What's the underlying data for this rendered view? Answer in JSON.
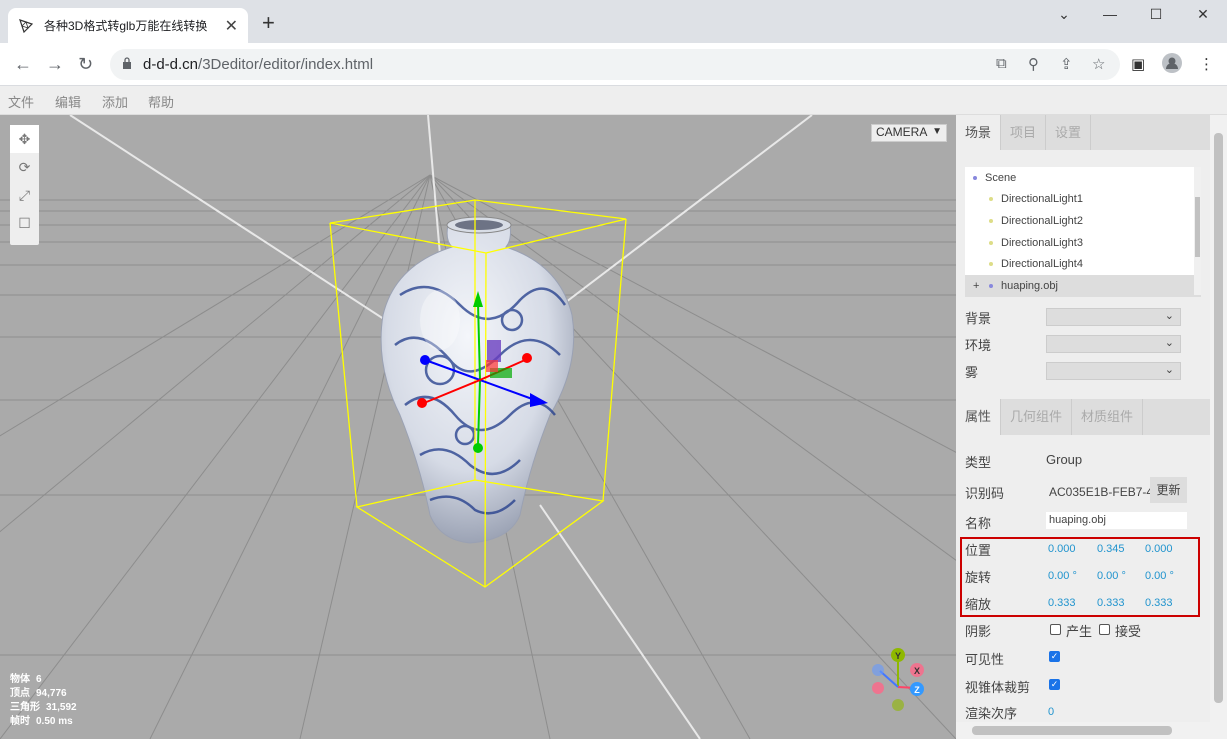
{
  "browser": {
    "tab_title": "各种3D格式转glb万能在线转换",
    "url_host": "d-d-d.cn",
    "url_path": "/3Deditor/editor/index.html",
    "new_tab": "+",
    "tab_close": "✕"
  },
  "menu": [
    "文件",
    "编辑",
    "添加",
    "帮助"
  ],
  "viewport": {
    "camera_select": "CAMERA",
    "info": [
      {
        "label": "物体",
        "value": "6"
      },
      {
        "label": "顶点",
        "value": "94,776"
      },
      {
        "label": "三角形",
        "value": "31,592"
      },
      {
        "label": "帧时",
        "value": "0.50 ms"
      }
    ],
    "axes": {
      "x": "X",
      "y": "Y",
      "z": "Z"
    }
  },
  "sidebar": {
    "top_tabs": [
      "场景",
      "项目",
      "设置"
    ],
    "outliner": [
      {
        "label": "Scene",
        "color": "#8888dd"
      },
      {
        "label": "DirectionalLight1",
        "color": "#dddd88"
      },
      {
        "label": "DirectionalLight2",
        "color": "#dddd88"
      },
      {
        "label": "DirectionalLight3",
        "color": "#dddd88"
      },
      {
        "label": "DirectionalLight4",
        "color": "#dddd88"
      },
      {
        "label": "huaping.obj",
        "color": "#8888dd",
        "expander": "+"
      }
    ],
    "background_label": "背景",
    "environment_label": "环境",
    "fog_label": "雾",
    "prop_tabs": [
      "属性",
      "几何组件",
      "材质组件"
    ],
    "type_label": "类型",
    "type_value": "Group",
    "uuid_label": "识别码",
    "uuid_value": "AC035E1B-FEB7-4",
    "update_button": "更新",
    "name_label": "名称",
    "name_value": "huaping.obj",
    "position_label": "位置",
    "position": [
      "0.000",
      "0.345",
      "0.000"
    ],
    "rotation_label": "旋转",
    "rotation": [
      "0.00 °",
      "0.00 °",
      "0.00 °"
    ],
    "scale_label": "缩放",
    "scale": [
      "0.333",
      "0.333",
      "0.333"
    ],
    "shadow_label": "阴影",
    "cast_label": "产生",
    "receive_label": "接受",
    "visible_label": "可见性",
    "frustum_label": "视锥体裁剪",
    "render_order_label": "渲染次序",
    "render_order_value": "0"
  },
  "colors": {
    "highlight": "#cc0000",
    "accent_number": "#2194ce",
    "viewport_bg": "#aaaaaa"
  }
}
